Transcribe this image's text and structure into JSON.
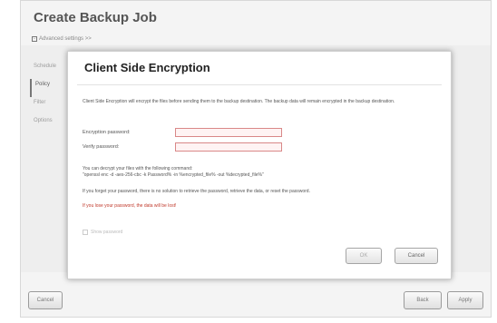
{
  "wizard": {
    "title": "Create Backup Job",
    "advanced_label": "Advanced settings >>",
    "nav": [
      "Schedule",
      "Policy",
      "Filter",
      "Options"
    ],
    "buttons": {
      "cancel": "Cancel",
      "back": "Back",
      "apply": "Apply"
    }
  },
  "dialog": {
    "title": "Client Side Encryption",
    "description": "Client Side Encryption will encrypt the files before sending them to the backup destination. The backup data will remain encrypted in the backup destination.",
    "fields": {
      "encryption_label": "Encryption password:",
      "encryption_value": "",
      "verify_label": "Verify password:",
      "verify_value": ""
    },
    "decrypt_note": "You can decrypt your files with the following command:",
    "command": "\"openssl enc -d -aes-256-cbc -k Password% -in %encrypted_file% -out %decrypted_file%\"",
    "forget_note": "If you forget your password, there is no solution to retrieve the password, retrieve the data, or reset the password.",
    "warning": "If you lose your password, the data will be lost!",
    "checkbox_label": "Show password",
    "buttons": {
      "ok": "OK",
      "cancel": "Cancel"
    }
  },
  "colors": {
    "warning": "#c0392b",
    "field_border": "#d98888",
    "field_bg": "#fff3f3"
  }
}
